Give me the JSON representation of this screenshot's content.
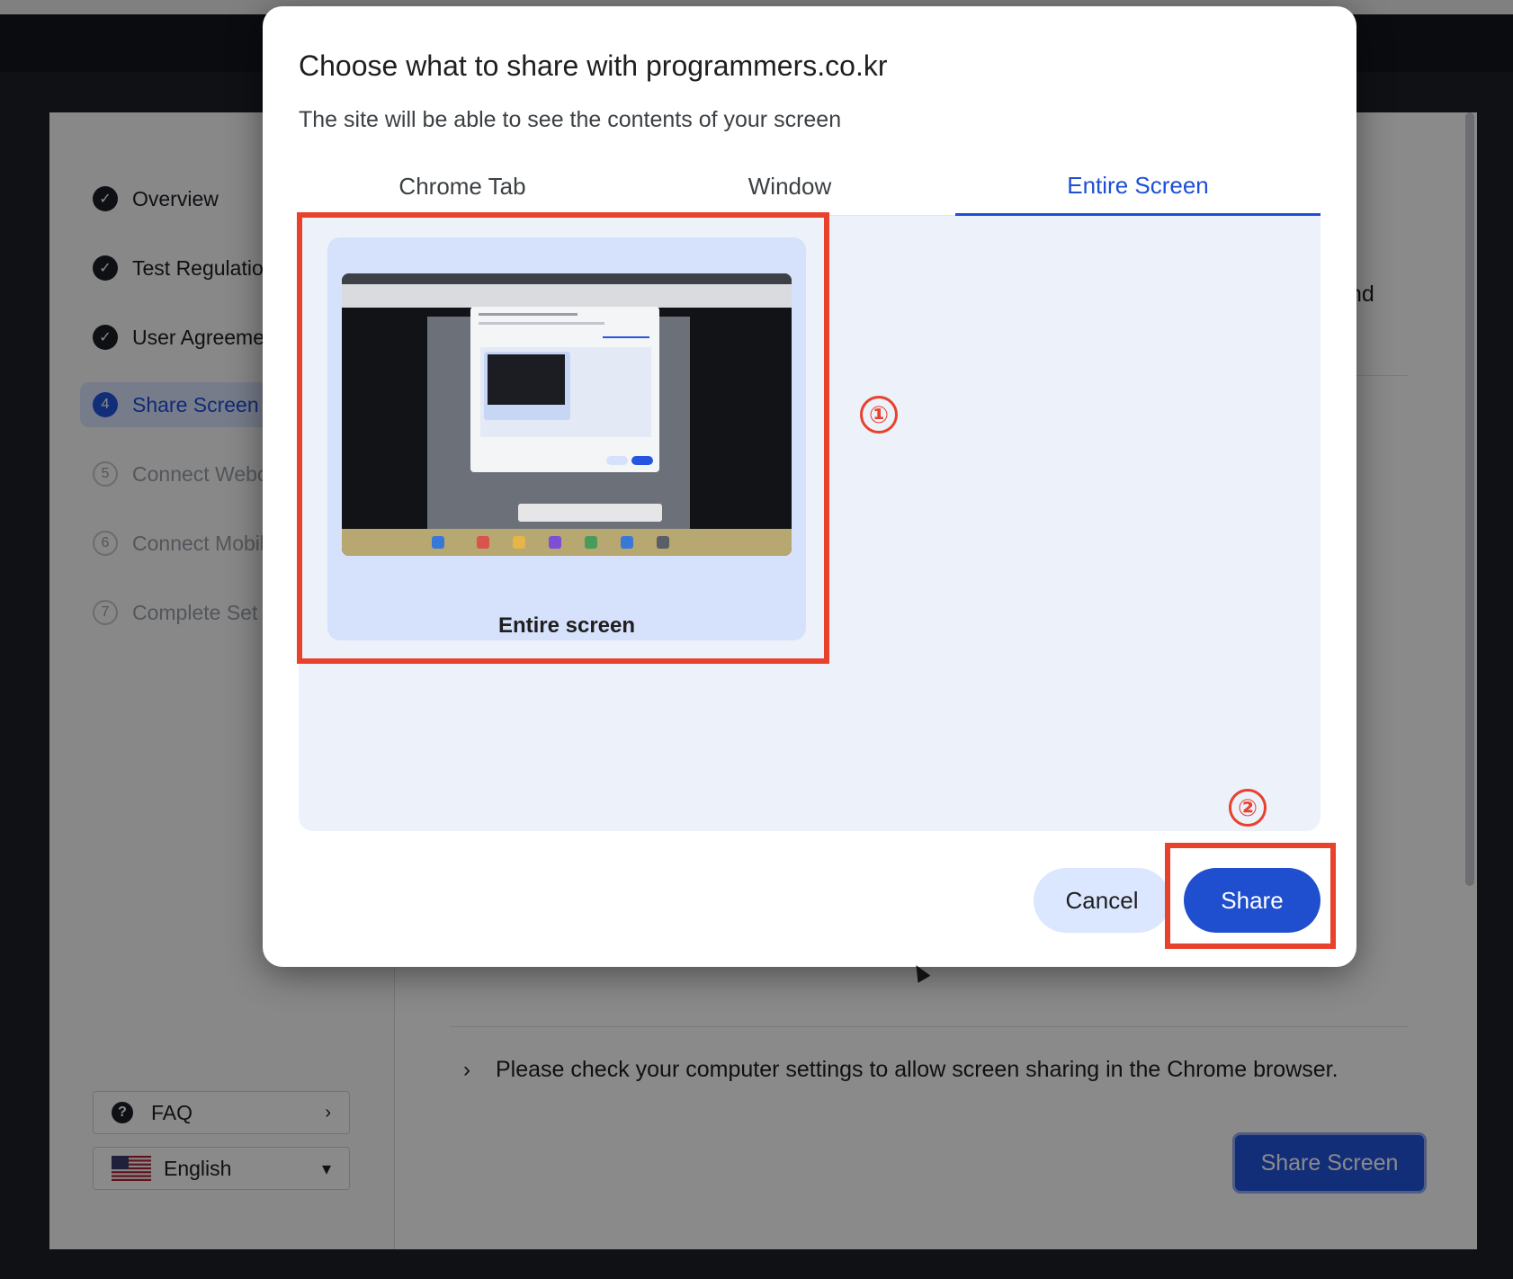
{
  "sidebar": {
    "steps": [
      {
        "label": "Overview",
        "state": "done"
      },
      {
        "label": "Test Regulation",
        "state": "done"
      },
      {
        "label": "User Agreemer",
        "state": "done"
      },
      {
        "label": "Share Screen",
        "state": "current",
        "number": "4"
      },
      {
        "label": "Connect Webc",
        "state": "todo",
        "number": "5"
      },
      {
        "label": "Connect Mobile",
        "state": "todo",
        "number": "6"
      },
      {
        "label": "Complete Set U",
        "state": "todo",
        "number": "7"
      }
    ],
    "faq_label": "FAQ",
    "language_label": "English"
  },
  "main": {
    "partial_text": "nd",
    "notice": "Please check your computer settings to allow screen sharing in the Chrome browser.",
    "share_screen_button": "Share Screen"
  },
  "dialog": {
    "title": "Choose what to share with programmers.co.kr",
    "subtitle": "The site will be able to see the contents of your screen",
    "tabs": [
      {
        "label": "Chrome Tab",
        "active": false
      },
      {
        "label": "Window",
        "active": false
      },
      {
        "label": "Entire Screen",
        "active": true
      }
    ],
    "source_label": "Entire screen",
    "cancel_label": "Cancel",
    "share_label": "Share"
  },
  "annotations": {
    "marker1": "①",
    "marker2": "②",
    "highlight_color": "#e8412c"
  },
  "colors": {
    "accent": "#1f4fce",
    "active_tab": "#1d4fd6",
    "content_bg": "#ecf1fa"
  }
}
